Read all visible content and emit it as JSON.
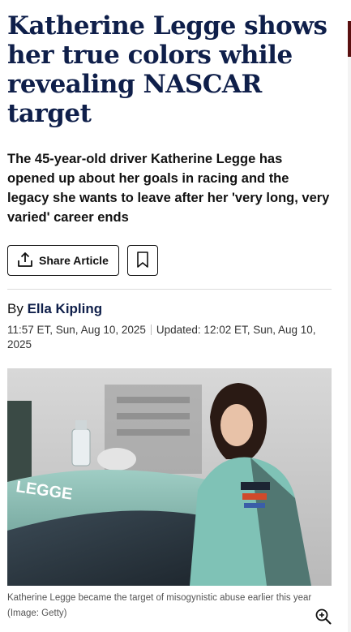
{
  "article": {
    "headline": "Katherine Legge shows her true colors while revealing NASCAR target",
    "standfirst": "The 45-year-old driver Katherine Legge has opened up about her goals in racing and the legacy she wants to leave after her 'very long, very varied' career ends",
    "share_label": "Share Article",
    "byline_prefix": "By",
    "author": "Ella Kipling",
    "published": "11:57 ET, Sun, Aug 10, 2025",
    "updated": "Updated: 12:02 ET, Sun, Aug 10, 2025",
    "photo_car_text": "LEGGE",
    "caption": "Katherine Legge became the target of misogynistic abuse earlier this year",
    "credit": "(Image: Getty)"
  },
  "icons": {
    "share": "share-icon",
    "bookmark": "bookmark-icon",
    "zoom": "zoom-in-icon"
  },
  "colors": {
    "headline": "#0f1f4a",
    "accent": "#5a1010"
  }
}
